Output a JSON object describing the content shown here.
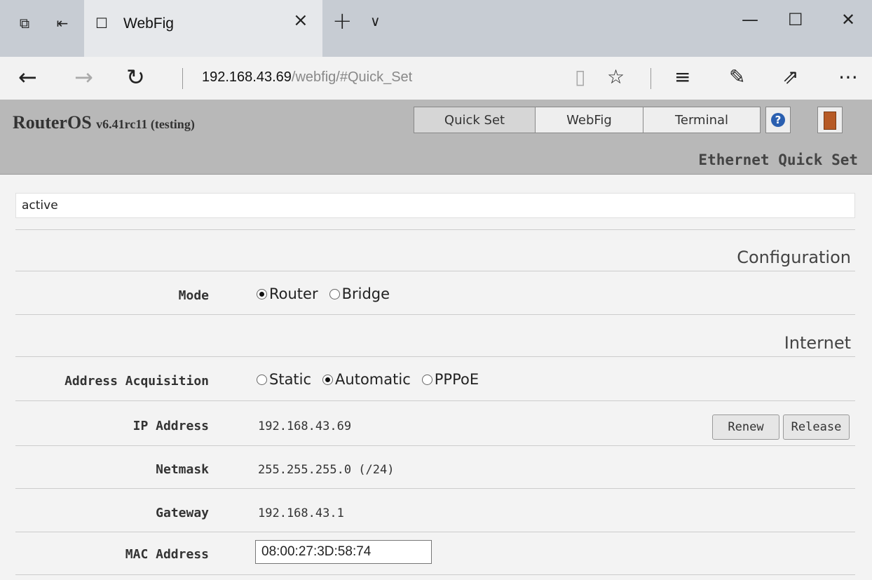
{
  "browser": {
    "tab_title": "WebFig",
    "url_host": "192.168.43.69",
    "url_path": "/webfig/#Quick_Set"
  },
  "routeros": {
    "title_main": "RouterOS",
    "title_version": "v6.41rc11 (testing)",
    "nav": [
      "Quick Set",
      "WebFig",
      "Terminal"
    ],
    "active_nav": "Quick Set",
    "page_title": "Ethernet Quick Set"
  },
  "quickset": {
    "status": "active",
    "section_configuration": "Configuration",
    "mode_label": "Mode",
    "mode_options": [
      "Router",
      "Bridge"
    ],
    "mode_selected": "Router",
    "section_internet": "Internet",
    "acq_label": "Address Acquisition",
    "acq_options": [
      "Static",
      "Automatic",
      "PPPoE"
    ],
    "acq_selected": "Automatic",
    "ip_label": "IP Address",
    "ip_value": "192.168.43.69",
    "renew_label": "Renew",
    "release_label": "Release",
    "netmask_label": "Netmask",
    "netmask_value": "255.255.255.0 (/24)",
    "gateway_label": "Gateway",
    "gateway_value": "192.168.43.1",
    "mac_label": "MAC Address",
    "mac_value": "08:00:27:3D:58:74"
  },
  "colors": {
    "header_bg": "#b8b8b8",
    "content_bg": "#f3f3f3",
    "tabbar_bg": "#c7ccd3"
  }
}
